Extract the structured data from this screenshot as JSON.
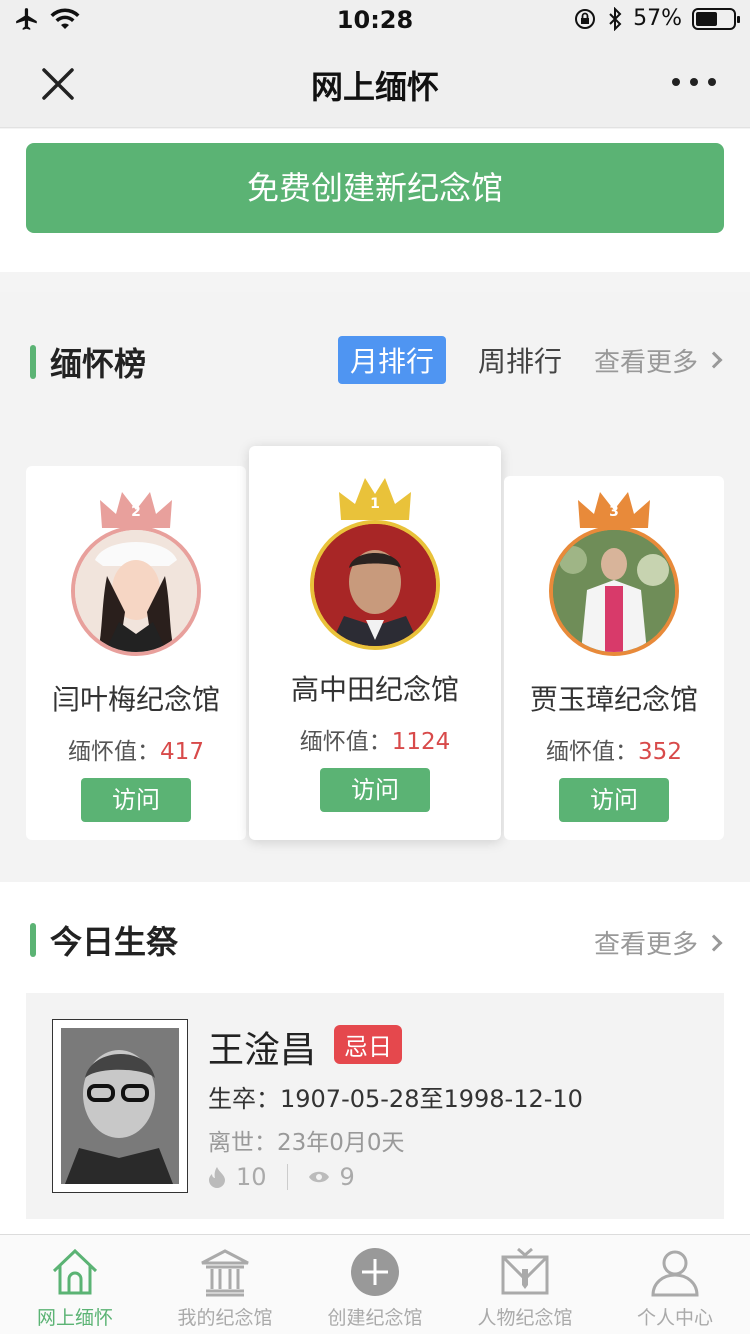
{
  "status_bar": {
    "time": "10:28",
    "battery": "57%",
    "battery_level": 0.57
  },
  "nav": {
    "title": "网上缅怀"
  },
  "create_button": "免费创建新纪念馆",
  "ranking": {
    "title": "缅怀榜",
    "tabs": [
      {
        "label": "月排行",
        "active": true
      },
      {
        "label": "周排行",
        "active": false
      }
    ],
    "see_more": "查看更多",
    "value_label": "缅怀值：",
    "visit_label": "访问",
    "cards": [
      {
        "rank": "2",
        "name": "闫叶梅纪念馆",
        "value": "417",
        "color": "#e8a09c"
      },
      {
        "rank": "1",
        "name": "高中田纪念馆",
        "value": "1124",
        "color": "#e9c23a"
      },
      {
        "rank": "3",
        "name": "贾玉璋纪念馆",
        "value": "352",
        "color": "#e88a3a"
      }
    ]
  },
  "today": {
    "title": "今日生祭",
    "see_more": "查看更多",
    "name": "王淦昌",
    "badge": "忌日",
    "life": "生卒：1907-05-28至1998-12-10",
    "passed": "离世：23年0月0天",
    "flames": "10",
    "views": "9"
  },
  "tabbar": [
    {
      "label": "网上缅怀",
      "icon": "home-icon",
      "active": true
    },
    {
      "label": "我的纪念馆",
      "icon": "memorial-hall-icon",
      "active": false
    },
    {
      "label": "创建纪念馆",
      "icon": "plus-circle-icon",
      "active": false
    },
    {
      "label": "人物纪念馆",
      "icon": "person-memorial-icon",
      "active": false
    },
    {
      "label": "个人中心",
      "icon": "user-icon",
      "active": false
    }
  ],
  "colors": {
    "accent": "#5bb374",
    "tab_active": "#4f95f2",
    "value_red": "#d84a4a",
    "badge_red": "#e5484d"
  }
}
